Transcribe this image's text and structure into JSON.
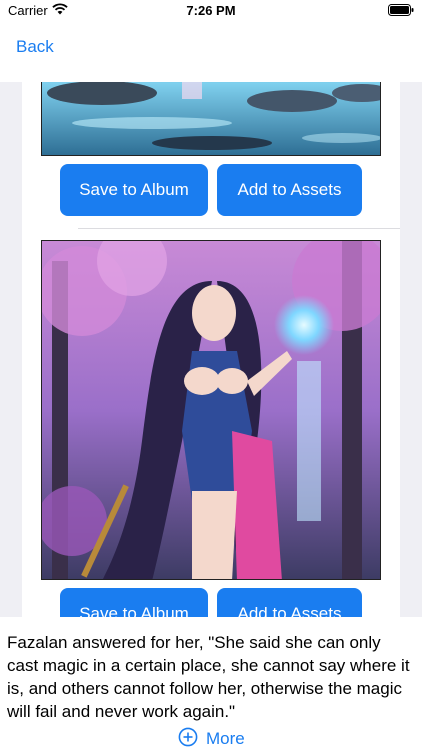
{
  "status_bar": {
    "carrier": "Carrier",
    "time": "7:26 PM",
    "wifi_icon": "wifi-icon",
    "battery_icon": "battery-icon"
  },
  "nav": {
    "back_label": "Back"
  },
  "items": [
    {
      "image_desc": "lake-scene-image",
      "save_label": "Save to Album",
      "assets_label": "Add to Assets"
    },
    {
      "image_desc": "fantasy-sorceress-image",
      "save_label": "Save to Album",
      "assets_label": "Add to Assets"
    }
  ],
  "story": {
    "text": "Fazalan answered for her, \"She said she can only cast magic in a certain place, she cannot say where it is, and others cannot follow her, otherwise the magic will fail and never work again.\"",
    "more_label": "More",
    "more_icon": "plus-circle-icon"
  },
  "colors": {
    "accent": "#1a7df0",
    "background": "#efeff4"
  }
}
